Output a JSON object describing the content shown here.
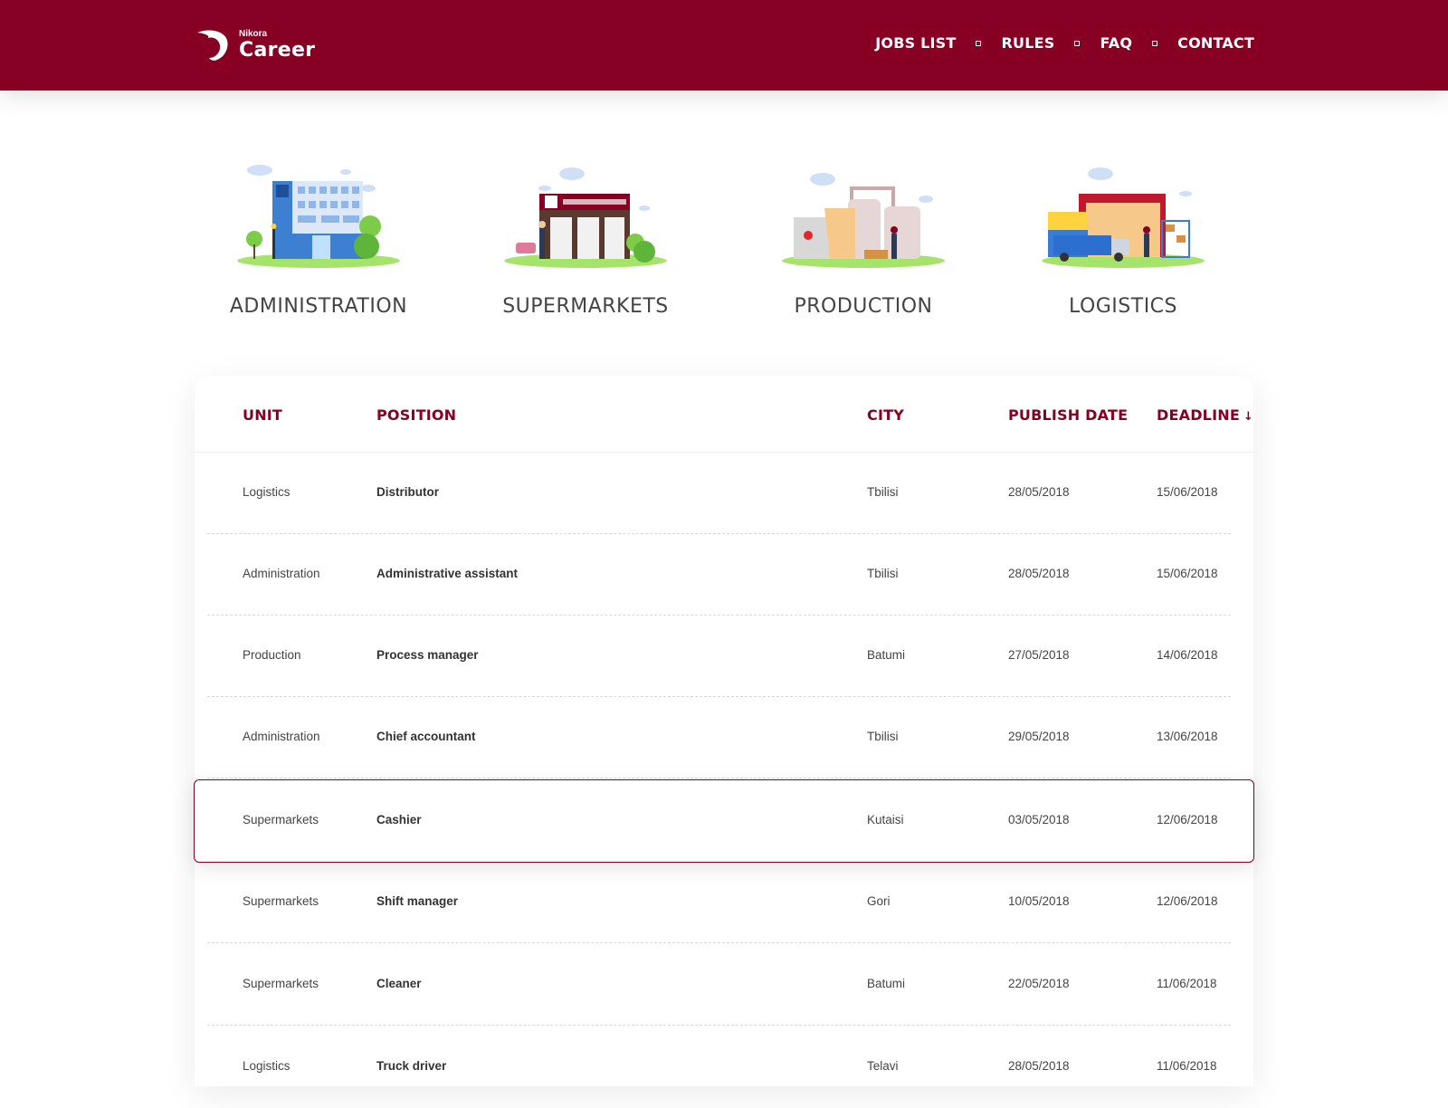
{
  "header": {
    "logo_small": "Nikora",
    "logo_big": "Career",
    "nav": [
      "JOBS LIST",
      "RULES",
      "FAQ",
      "CONTACT"
    ]
  },
  "categories": [
    {
      "label": "ADMINISTRATION",
      "icon": "office-building-illustration"
    },
    {
      "label": "SUPERMARKETS",
      "icon": "supermarket-illustration"
    },
    {
      "label": "PRODUCTION",
      "icon": "factory-illustration"
    },
    {
      "label": "LOGISTICS",
      "icon": "warehouse-truck-illustration"
    }
  ],
  "table": {
    "headers": {
      "unit": "UNIT",
      "position": "POSITION",
      "city": "CITY",
      "publish_date": "PUBLISH DATE",
      "deadline": "DEADLINE"
    },
    "sort_icon": "arrow-down-icon",
    "rows": [
      {
        "unit": "Logistics",
        "position": "Distributor",
        "city": "Tbilisi",
        "publish": "28/05/2018",
        "deadline": "15/06/2018"
      },
      {
        "unit": "Administration",
        "position": "Administrative assistant",
        "city": "Tbilisi",
        "publish": "28/05/2018",
        "deadline": "15/06/2018"
      },
      {
        "unit": "Production",
        "position": "Process manager",
        "city": "Batumi",
        "publish": "27/05/2018",
        "deadline": "14/06/2018"
      },
      {
        "unit": "Administration",
        "position": "Chief accountant",
        "city": "Tbilisi",
        "publish": "29/05/2018",
        "deadline": "13/06/2018"
      },
      {
        "unit": "Supermarkets",
        "position": "Cashier",
        "city": "Kutaisi",
        "publish": "03/05/2018",
        "deadline": "12/06/2018"
      },
      {
        "unit": "Supermarkets",
        "position": "Shift manager",
        "city": "Gori",
        "publish": "10/05/2018",
        "deadline": "12/06/2018"
      },
      {
        "unit": "Supermarkets",
        "position": "Cleaner",
        "city": "Batumi",
        "publish": "22/05/2018",
        "deadline": "11/06/2018"
      },
      {
        "unit": "Logistics",
        "position": "Truck driver",
        "city": "Telavi",
        "publish": "28/05/2018",
        "deadline": "11/06/2018"
      }
    ]
  },
  "colors": {
    "brand": "#870023",
    "text": "#444444",
    "grass": "#a6e36a"
  }
}
